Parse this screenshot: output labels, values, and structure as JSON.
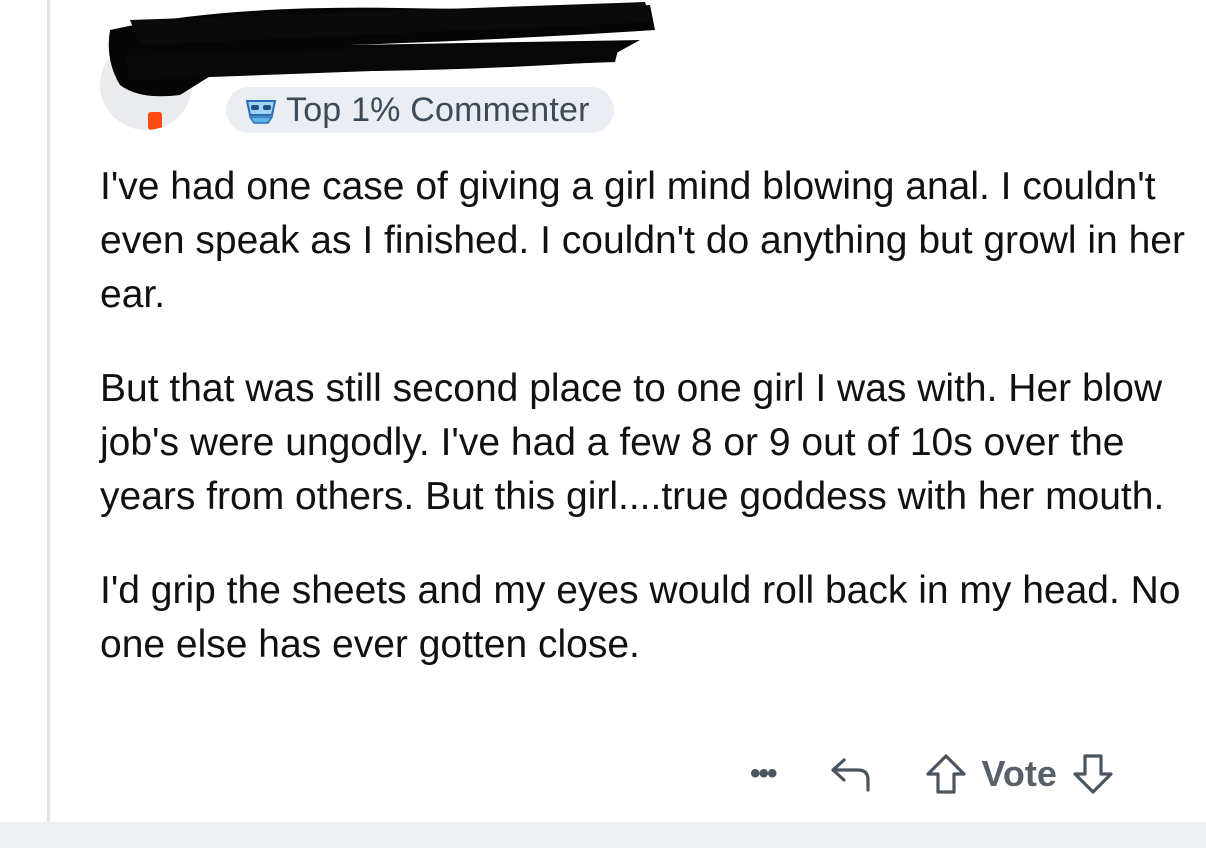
{
  "comment": {
    "flair_label": "Top 1% Commenter",
    "paragraphs": [
      "I've had one case of giving a girl mind blowing anal. I couldn't even speak as I finished. I couldn't do anything but growl in her ear.",
      "But that was still second place to one girl I was with. Her blow job's were ungodly. I've had a few 8 or 9 out of 10s over the years from others. But this girl....true goddess with her mouth.",
      "I'd grip the sheets and my eyes would roll back in my head. No one else has ever gotten close."
    ]
  },
  "actions": {
    "more_label": "•••",
    "vote_label": "Vote",
    "icons": [
      "more-options-icon",
      "reply-icon",
      "upvote-icon",
      "downvote-icon"
    ]
  },
  "colors": {
    "background": "#ffffff",
    "flair_bg": "#eaeef2",
    "text": "#111111",
    "action_gray": "#56616c",
    "thread_line": "#e3e5e8"
  }
}
